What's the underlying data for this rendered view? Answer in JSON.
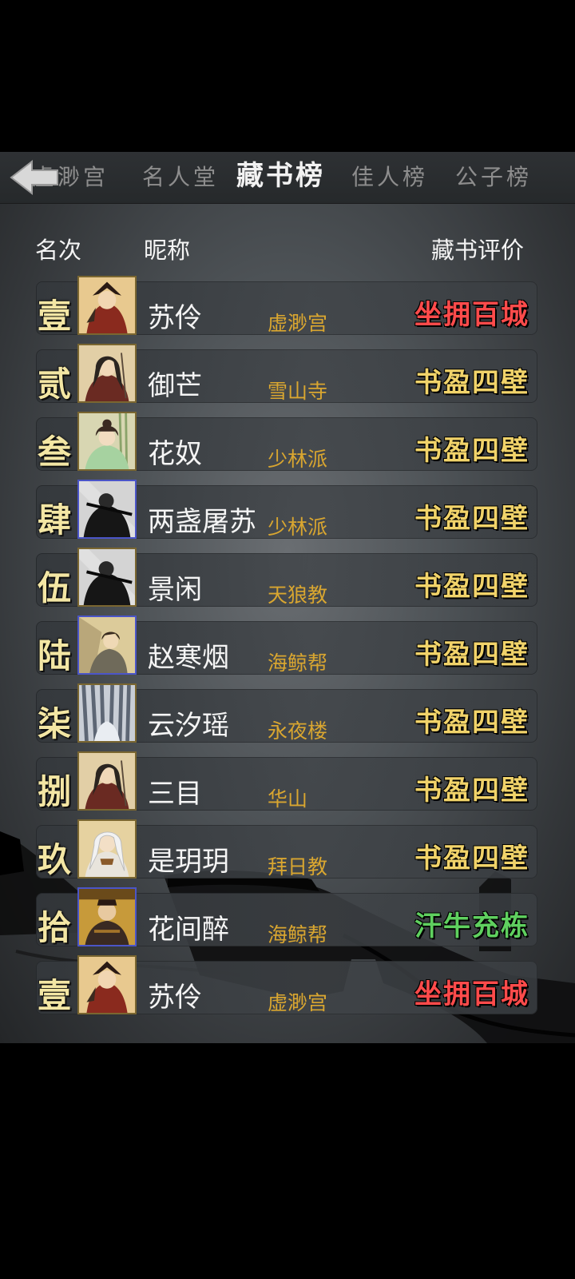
{
  "tabs": [
    {
      "label": "虚渺宫"
    },
    {
      "label": "名人堂"
    },
    {
      "label": "藏书榜"
    },
    {
      "label": "佳人榜"
    },
    {
      "label": "公子榜"
    }
  ],
  "headers": {
    "rank": "名次",
    "nickname": "昵称",
    "rating": "藏书评价"
  },
  "colors": {
    "gold": "#f1d36a",
    "red": "#ff4b4b",
    "green": "#5fd05f",
    "sect": "#d9a630"
  },
  "rows": [
    {
      "rank": "壹",
      "name": "苏伶",
      "sect": "虚渺宫",
      "rating": "坐拥百城",
      "rating_color": "red",
      "avatar": "warrior-portrait-icon"
    },
    {
      "rank": "贰",
      "name": "御芒",
      "sect": "雪山寺",
      "rating": "书盈四壁",
      "rating_color": "gold",
      "avatar": "swordswoman-portrait-icon"
    },
    {
      "rank": "叁",
      "name": "花奴",
      "sect": "少林派",
      "rating": "书盈四壁",
      "rating_color": "gold",
      "avatar": "lady-portrait-icon"
    },
    {
      "rank": "肆",
      "name": "两盏屠苏",
      "sect": "少林派",
      "rating": "书盈四壁",
      "rating_color": "gold",
      "avatar": "ink-swordsman-portrait-icon"
    },
    {
      "rank": "伍",
      "name": "景闲",
      "sect": "天狼教",
      "rating": "书盈四壁",
      "rating_color": "gold",
      "avatar": "ink-swordsman-portrait-icon"
    },
    {
      "rank": "陆",
      "name": "赵寒烟",
      "sect": "海鲸帮",
      "rating": "书盈四壁",
      "rating_color": "gold",
      "avatar": "scholar-portrait-icon"
    },
    {
      "rank": "柒",
      "name": "云汐瑶",
      "sect": "永夜楼",
      "rating": "书盈四壁",
      "rating_color": "gold",
      "avatar": "veiled-portrait-icon"
    },
    {
      "rank": "捌",
      "name": "三目",
      "sect": "华山",
      "rating": "书盈四壁",
      "rating_color": "gold",
      "avatar": "swordswoman-portrait-icon"
    },
    {
      "rank": "玖",
      "name": "是玥玥",
      "sect": "拜日教",
      "rating": "书盈四壁",
      "rating_color": "gold",
      "avatar": "white-hair-portrait-icon"
    },
    {
      "rank": "拾",
      "name": "花间醉",
      "sect": "海鲸帮",
      "rating": "汗牛充栋",
      "rating_color": "green",
      "avatar": "monk-portrait-icon"
    },
    {
      "rank": "壹",
      "name": "苏伶",
      "sect": "虚渺宫",
      "rating": "坐拥百城",
      "rating_color": "red",
      "avatar": "warrior-portrait-icon"
    }
  ]
}
